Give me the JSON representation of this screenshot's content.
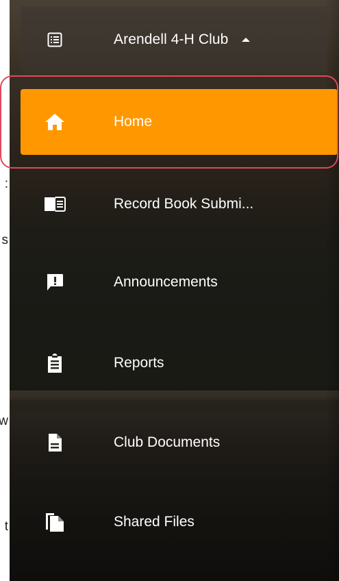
{
  "header": {
    "club_name": "Arendell 4-H Club",
    "icon": "list-box-icon",
    "caret_icon": "caret-up-icon"
  },
  "nav": {
    "items": [
      {
        "label": "Home",
        "icon": "home-icon",
        "active": true
      },
      {
        "label": "Record Book Submi...",
        "icon": "record-book-icon",
        "active": false
      },
      {
        "label": "Announcements",
        "icon": "announcement-icon",
        "active": false
      },
      {
        "label": "Reports",
        "icon": "clipboard-icon",
        "active": false
      },
      {
        "label": "Club Documents",
        "icon": "document-icon",
        "active": false
      },
      {
        "label": "Shared Files",
        "icon": "shared-files-icon",
        "active": false
      }
    ]
  },
  "background_page": {
    "partial_chars": [
      ":",
      "s",
      "w",
      "t"
    ]
  },
  "colors": {
    "active_bg": "#ff9800",
    "highlight_ring": "#e0485d",
    "text": "#ffffff"
  }
}
